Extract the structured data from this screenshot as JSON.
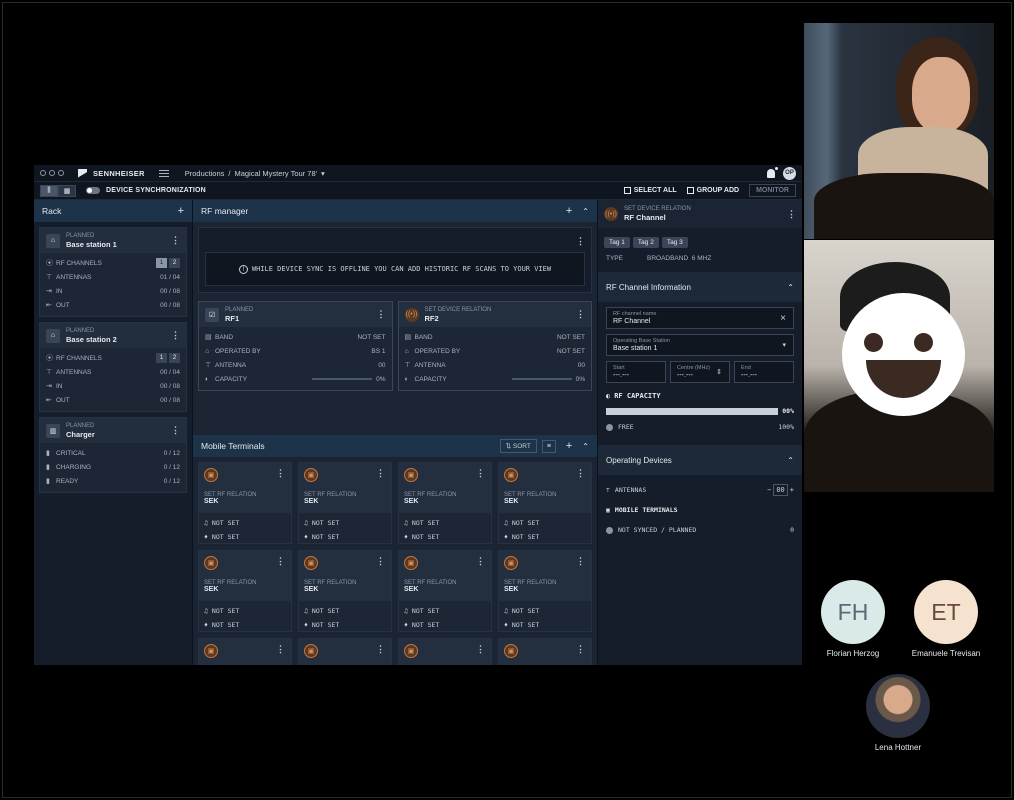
{
  "app": {
    "brand": "SENNHEISER",
    "breadcrumb": [
      "Productions",
      "/",
      "Magical Mystery Tour 78'",
      "▾"
    ],
    "user_initials": "OP"
  },
  "toolbar": {
    "sync_label": "DEVICE SYNCHRONIZATION",
    "select_all": "SELECT ALL",
    "group_add": "GROUP ADD",
    "monitor": "MONITOR"
  },
  "rack": {
    "title": "Rack",
    "stations": [
      {
        "status": "PLANNED",
        "name": "Base station 1",
        "rows": [
          {
            "label": "RF CHANNELS"
          },
          {
            "label": "ANTENNAS",
            "value": "01 / 04"
          },
          {
            "label": "IN",
            "value": "00 / 08"
          },
          {
            "label": "OUT",
            "value": "00 / 08"
          }
        ]
      },
      {
        "status": "PLANNED",
        "name": "Base station 2",
        "rows": [
          {
            "label": "RF CHANNELS"
          },
          {
            "label": "ANTENNAS",
            "value": "00 / 04"
          },
          {
            "label": "IN",
            "value": "00 / 08"
          },
          {
            "label": "OUT",
            "value": "00 / 08"
          }
        ]
      }
    ],
    "rf_pills": [
      "1",
      "2"
    ],
    "charger": {
      "status": "PLANNED",
      "name": "Charger",
      "rows": [
        {
          "label": "CRITICAL",
          "value": "0 / 12"
        },
        {
          "label": "CHARGING",
          "value": "0 / 12"
        },
        {
          "label": "READY",
          "value": "0 / 12"
        }
      ]
    }
  },
  "rf_manager": {
    "title": "RF manager",
    "notice": "WHILE DEVICE SYNC IS OFFLINE YOU CAN ADD HISTORIC RF SCANS TO YOUR VIEW",
    "channels": [
      {
        "status": "PLANNED",
        "name": "RF1",
        "rows": [
          {
            "label": "BAND",
            "value": "NOT SET"
          },
          {
            "label": "OPERATED BY",
            "value": "BS 1"
          },
          {
            "label": "ANTENNA",
            "value": "00"
          },
          {
            "label": "CAPACITY",
            "value": "0%"
          }
        ]
      },
      {
        "status": "SET DEVICE RELATION",
        "name": "RF2",
        "rows": [
          {
            "label": "BAND",
            "value": "NOT SET"
          },
          {
            "label": "OPERATED BY",
            "value": "NOT SET"
          },
          {
            "label": "ANTENNA",
            "value": "00"
          },
          {
            "label": "CAPACITY",
            "value": "0%"
          }
        ]
      }
    ]
  },
  "mobile_terminals": {
    "title": "Mobile Terminals",
    "sort": "SORT",
    "card": {
      "relation": "SET RF RELATION",
      "name": "SEK",
      "row1": "NOT SET",
      "row2": "NOT SET"
    }
  },
  "detail": {
    "header_status": "SET DEVICE RELATION",
    "header_name": "RF Channel",
    "tags": [
      "Tag 1",
      "Tag 2",
      "Tag 3"
    ],
    "type_label": "TYPE",
    "type_value": "BROADBAND",
    "type_unit": "6 MHZ",
    "info_title": "RF Channel Information",
    "name_label": "RF channel name",
    "name_value": "RF Channel",
    "bs_label": "Operating Base Station",
    "bs_value": "Base station 1",
    "start_label": "Start",
    "start_value": "---.---",
    "centre_label": "Centre (MHz)",
    "centre_value": "---.---",
    "end_label": "End",
    "end_value": "---.---",
    "capacity_label": "RF CAPACITY",
    "capacity_value": "00%",
    "free_label": "FREE",
    "free_value": "100%",
    "devices_title": "Operating Devices",
    "antennas_label": "ANTENNAS",
    "antennas_value": "00",
    "mt_label": "MOBILE TERMINALS",
    "ns_label": "NOT SYNCED / PLANNED",
    "ns_value": "0"
  },
  "participants": [
    {
      "initials": "FH",
      "name": "Florian Herzog"
    },
    {
      "initials": "ET",
      "name": "Emanuele Trevisan"
    },
    {
      "name": "Lena Hottner"
    }
  ]
}
